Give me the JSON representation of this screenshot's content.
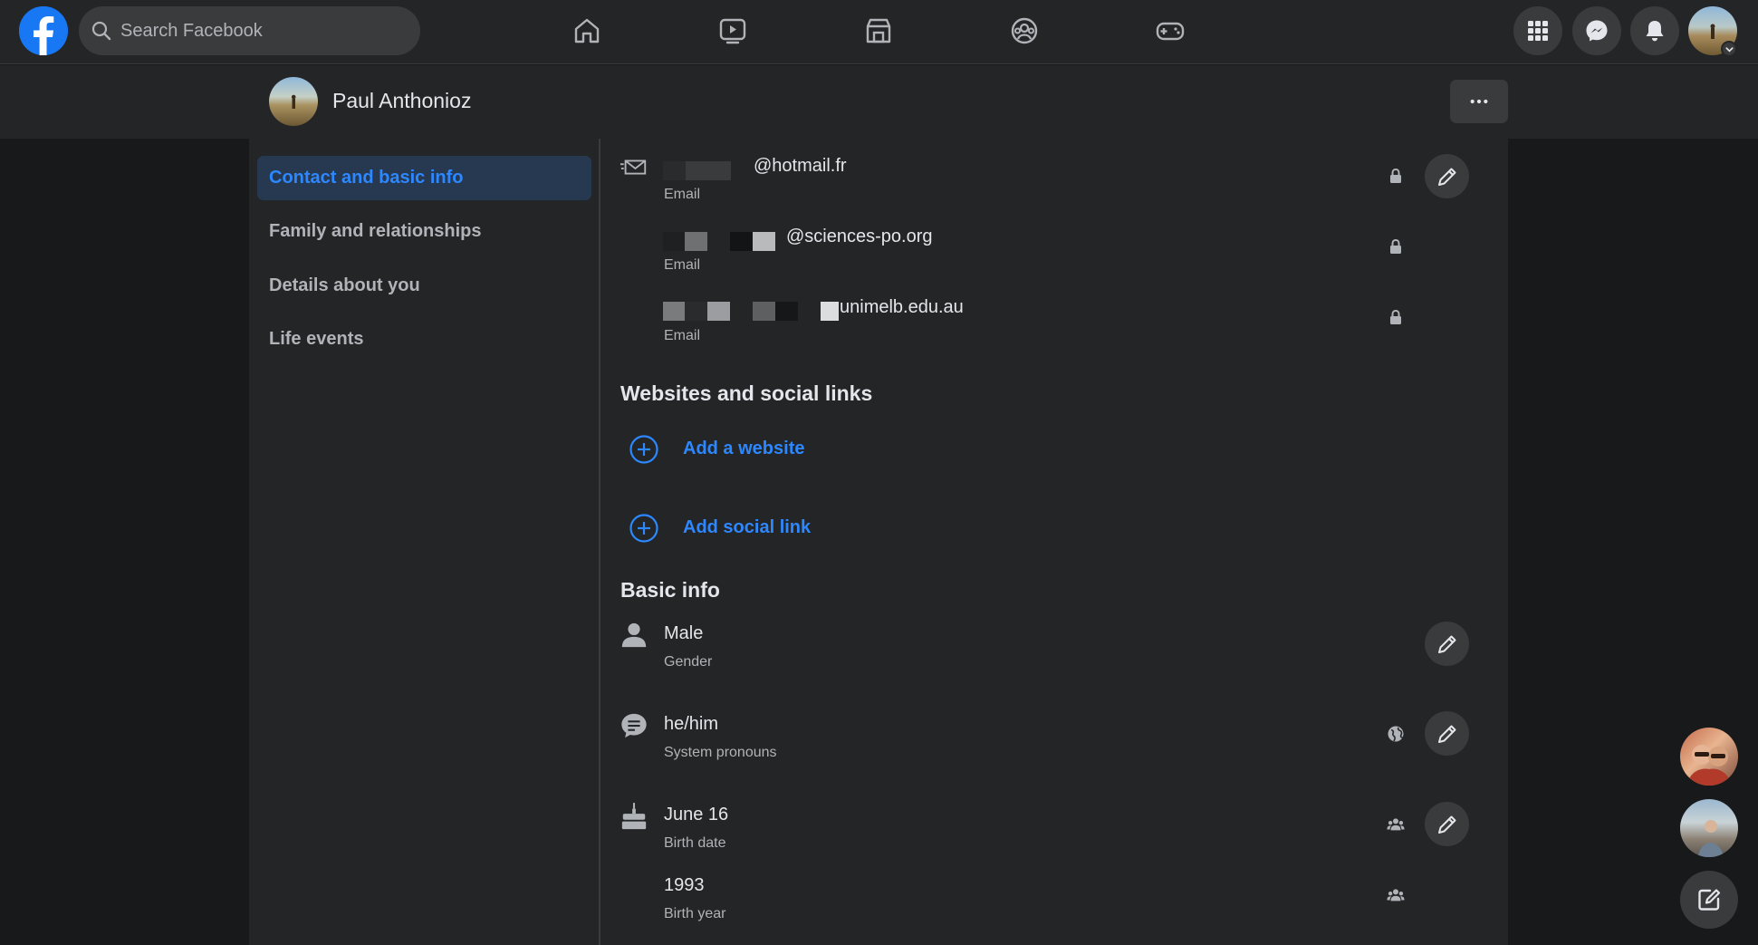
{
  "topbar": {
    "search_placeholder": "Search Facebook",
    "nav_icons": [
      "home-icon",
      "watch-icon",
      "marketplace-icon",
      "groups-icon",
      "gaming-icon"
    ],
    "right_icons": [
      "menu-grid-icon",
      "messenger-icon",
      "notifications-bell-icon",
      "account-avatar"
    ]
  },
  "profile": {
    "name": "Paul Anthonioz"
  },
  "sidebar": {
    "items": [
      {
        "label": "Contact and basic info",
        "active": true
      },
      {
        "label": "Family and relationships",
        "active": false
      },
      {
        "label": "Details about you",
        "active": false
      },
      {
        "label": "Life events",
        "active": false
      }
    ]
  },
  "contact": {
    "emails": [
      {
        "value": "@hotmail.fr",
        "label": "Email",
        "privacy": "lock-icon",
        "editable": true
      },
      {
        "value": "@sciences-po.org",
        "label": "Email",
        "privacy": "lock-icon",
        "editable": false
      },
      {
        "value": "unimelb.edu.au",
        "label": "Email",
        "privacy": "lock-icon",
        "editable": false
      }
    ]
  },
  "websites": {
    "title": "Websites and social links",
    "add_website": "Add a website",
    "add_social": "Add social link"
  },
  "basic_info": {
    "title": "Basic info",
    "rows": [
      {
        "value": "Male",
        "label": "Gender",
        "icon": "person-icon",
        "privacy": "",
        "editable": true
      },
      {
        "value": "he/him",
        "label": "System pronouns",
        "icon": "speech-bubble-icon",
        "privacy": "globe-icon",
        "editable": true
      },
      {
        "value": "June 16",
        "label": "Birth date",
        "icon": "birthday-cake-icon",
        "privacy": "friends-icon",
        "editable": true
      },
      {
        "value": "1993",
        "label": "Birth year",
        "icon": "",
        "privacy": "friends-icon",
        "editable": false
      }
    ]
  },
  "colors": {
    "background": "#18191a",
    "surface": "#242526",
    "accent": "#2d88ff",
    "active_bg": "#263951"
  }
}
